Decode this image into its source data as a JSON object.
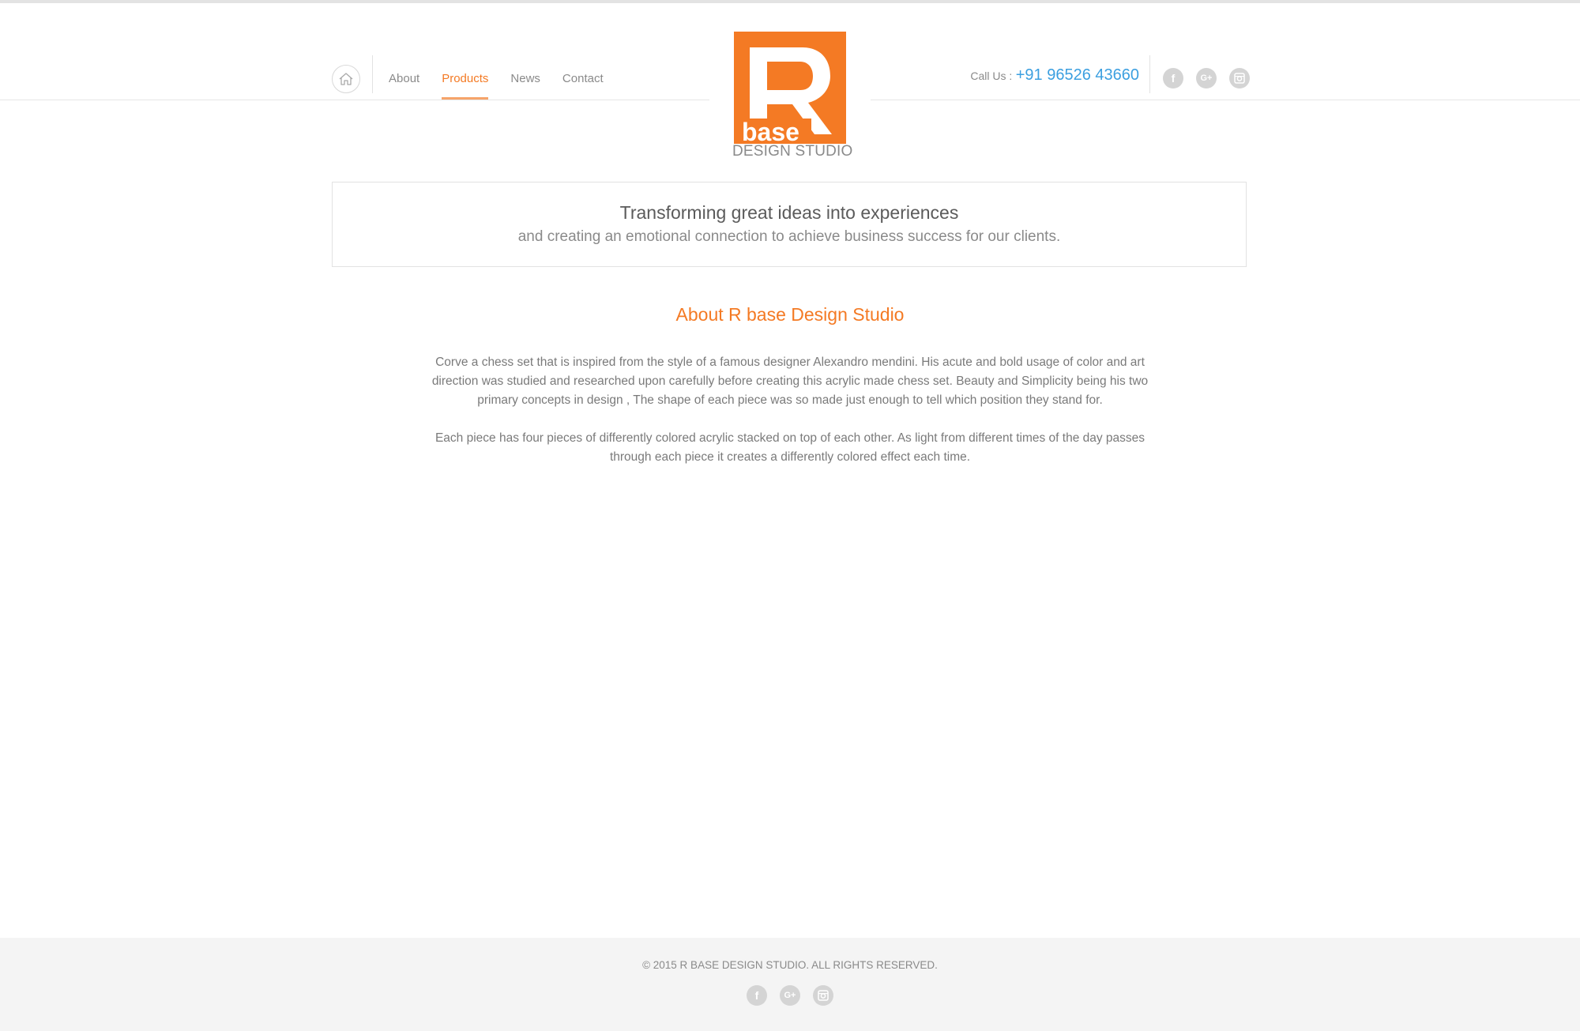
{
  "nav": {
    "items": [
      {
        "label": "About",
        "active": false
      },
      {
        "label": "Products",
        "active": true
      },
      {
        "label": "News",
        "active": false
      },
      {
        "label": "Contact",
        "active": false
      }
    ]
  },
  "logo": {
    "base_text": "base",
    "caption": "DESIGN STUDIO",
    "brand_color": "#f47a24"
  },
  "contact": {
    "call_label": "Call Us :",
    "phone": "+91 96526 43660",
    "phone_color": "#3b9fe0"
  },
  "social": {
    "facebook_glyph": "f",
    "google_plus_glyph": "G+",
    "instagram_icon": "instagram-icon"
  },
  "tagline": {
    "title": "Transforming great ideas into experiences",
    "subtitle": "and creating an emotional connection to achieve business success for our clients."
  },
  "about": {
    "title": "About R base Design Studio",
    "paragraphs": [
      "Corve a chess set that is inspired from the style of a famous designer Alexandro  mendini. His acute and bold usage of color and art direction was studied and researched upon carefully before creating this acrylic made chess set. Beauty and Simplicity being his two primary concepts in design , The shape of each piece was so made just enough to tell which position they stand for.",
      "Each piece has four pieces of differently colored acrylic stacked on top of each other. As light from different times of the day passes through each piece it creates a differently colored effect each time."
    ]
  },
  "footer": {
    "copyright": "© 2015 R BASE DESIGN STUDIO. ALL RIGHTS RESERVED."
  }
}
